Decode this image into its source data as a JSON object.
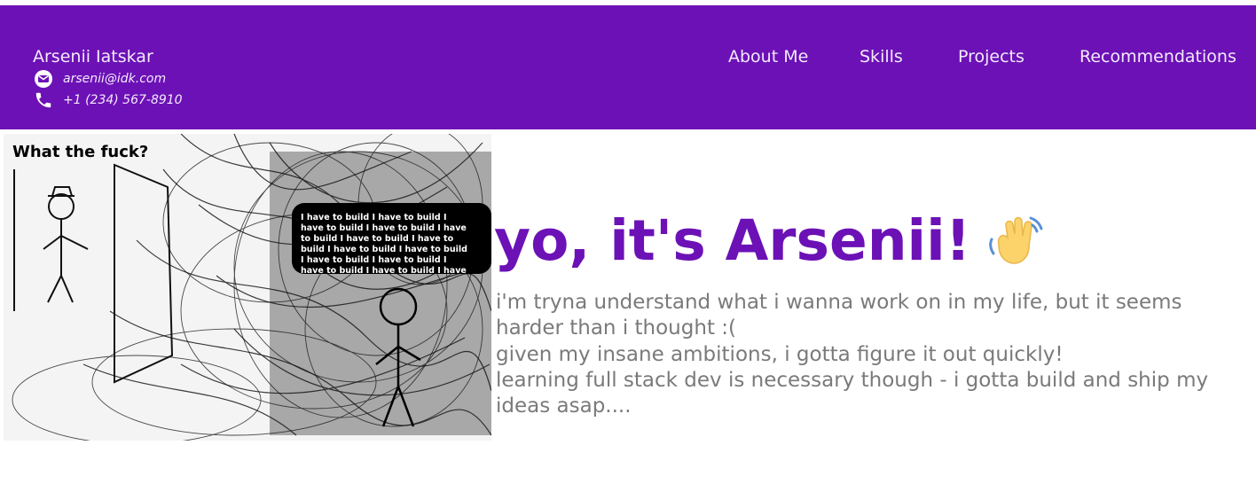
{
  "header": {
    "name": "Arsenii Iatskar",
    "email": "arsenii@idk.com",
    "phone": "+1 (234) 567-8910",
    "email_icon": "email-icon",
    "phone_icon": "phone-icon"
  },
  "nav": {
    "items": [
      "About Me",
      "Skills",
      "Projects",
      "Recommendations"
    ]
  },
  "hero": {
    "image": {
      "caption": "What the fuck?",
      "speech": [
        "I have to build I have to build I",
        "have to build I have to build I have",
        "to build I have to build I have to",
        "build I have to build I have to build",
        "I have to build I have to build I",
        "have to build I have to build I have"
      ]
    },
    "title": "yo, it's Arsenii!",
    "wave_icon": "waving-hand-icon",
    "lines": [
      "i'm tryna understand what i wanna work on in my life, but it seems harder than i thought :(",
      "given my insane ambitions, i gotta figure it out quickly!",
      "learning full stack dev is necessary though - i gotta build and ship my ideas asap...."
    ]
  },
  "colors": {
    "header_bg": "#6c11b6",
    "title": "#6c11b6",
    "body_text": "#7a7a7a"
  }
}
